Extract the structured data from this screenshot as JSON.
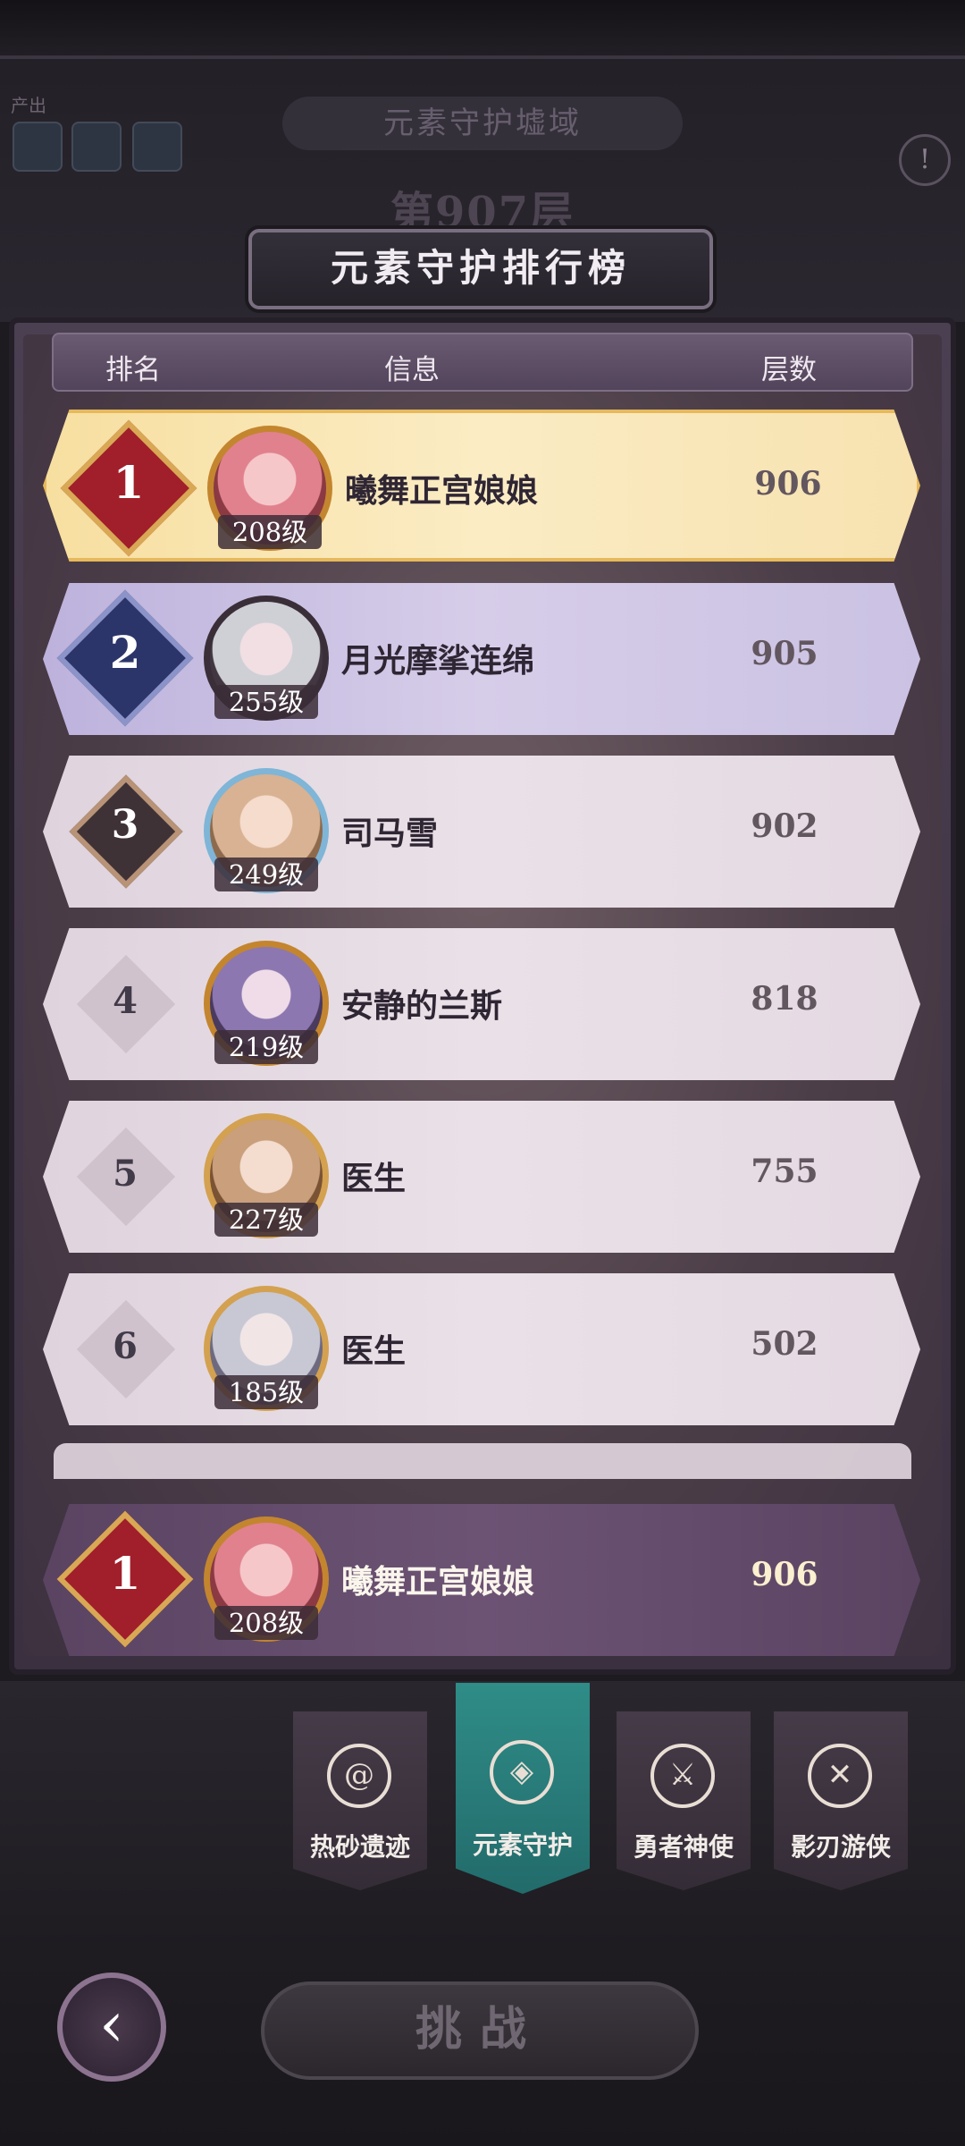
{
  "background": {
    "output_label": "产出",
    "realm_title": "元素守护墟域",
    "floor_title": "第907层"
  },
  "leaderboard": {
    "title": "元素守护排行榜",
    "columns": {
      "rank": "排名",
      "info": "信息",
      "floors": "层数"
    },
    "entries": [
      {
        "rank": "1",
        "name": "曦舞正宫娘娘",
        "level": "208级",
        "floors": "906"
      },
      {
        "rank": "2",
        "name": "月光摩挲连绵",
        "level": "255级",
        "floors": "905"
      },
      {
        "rank": "3",
        "name": "司马雪",
        "level": "249级",
        "floors": "902"
      },
      {
        "rank": "4",
        "name": "安静的兰斯",
        "level": "219级",
        "floors": "818"
      },
      {
        "rank": "5",
        "name": "医生",
        "level": "227级",
        "floors": "755"
      },
      {
        "rank": "6",
        "name": "医生",
        "level": "185级",
        "floors": "502"
      }
    ],
    "my_entry": {
      "rank": "1",
      "name": "曦舞正宫娘娘",
      "level": "208级",
      "floors": "906"
    }
  },
  "tabs": [
    {
      "label": "热砂遗迹",
      "icon": "swirl-icon",
      "active": false
    },
    {
      "label": "元素守护",
      "icon": "element-shield-icon",
      "active": true
    },
    {
      "label": "勇者神使",
      "icon": "crossed-swords-icon",
      "active": false
    },
    {
      "label": "影刃游侠",
      "icon": "crossed-blades-icon",
      "active": false
    }
  ],
  "controls": {
    "back_icon": "back-arrow-icon",
    "challenge_label": "挑战"
  },
  "colors": {
    "gold_row": "#f7dfa0",
    "silver_row": "#cbc2e3",
    "active_tab": "#2f8c87"
  }
}
